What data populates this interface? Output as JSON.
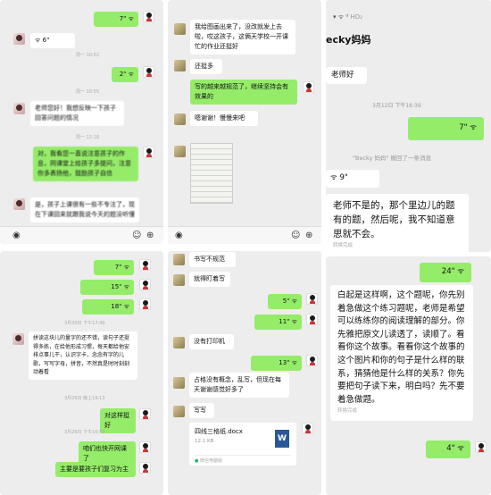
{
  "p1": {
    "b1": "7\"",
    "v1": "6\"",
    "ts1": "周一 10:52",
    "b2": "2\"",
    "ts2": "周一 10:55",
    "m1": "老师您好！我想反映一下孩子回答问题的情况",
    "ts3": "周一 12:18",
    "m2": "对，我看您一直说注意孩子的作息，同课堂上给孩子多提问，注意你多表扬他，鼓励孩子自信",
    "m3": "是，孩子上课很有一些不专注了，现在下课回来就跟我说今天的题没听懂"
  },
  "p2": {
    "m1": "我给图画出来了，没改就发上去啦，哎这孩子，这俩天学校一开课忙的作业还挺好",
    "m2": "还挺多",
    "m3": "写的越来越规范了，继续坚持会有效果的",
    "m4": "嗯谢谢！慢慢来吧"
  },
  "p3": {
    "title": "ecky妈妈",
    "m1": "老师好",
    "ts1": "3月12日 下午16:39",
    "b1": "7\"",
    "recall": "\"Becky 妈妈\" 撤回了一条消息",
    "v1": "9\"",
    "m2": "老师不是的，那个里边儿的题有的题，然后呢，我不知道意思就不会。",
    "done1": "转换完成",
    "b2": "24\"",
    "m3": "白起是这样啊，这个题呢，你先别着急做这个练习题呢，老师是希望可以练练你的阅读理解的部分。你先雅把原文儿读透了，读顺了。看看你这个故事。看看你这个故事的这个图片和你的句子是什么样的联系，猜猜他是什么样的关系？你先要把句子读下来，明白吗？先不要着急做题。",
    "done2": "转换完成",
    "b3": "4\""
  },
  "p4": {
    "b1": "7\"",
    "b2": "15\"",
    "b3": "18\"",
    "ts1": "3月30日 下午17:49",
    "m1": "拼读这块儿的量字的还不错，读句子还挺得多练，在给他形成习惯，每天都给他安排点事儿干，认识字卡，念念有字的儿歌，写写字母，拼音，不然真是时时刻刻动着看",
    "ts2": "3月26日 晚上19:13",
    "m2": "对这样挺好",
    "ts3": "3月26日 下午16:53",
    "m3": "咱们也快开网课了",
    "m4": "主要是要孩子们复习为主"
  },
  "p5": {
    "m1": "书写不规范",
    "m2": "就得盯着写",
    "b1": "5\"",
    "b2": "11\"",
    "m3": "没有打印机",
    "b3": "13\"",
    "m4": "占格没有概念，乱写，但现在每天谢谢感觉好多了",
    "m5": "写写",
    "file_name": "四线三格纸.docx",
    "file_size": "12.1 KB",
    "file_app": "微信电脑版"
  }
}
